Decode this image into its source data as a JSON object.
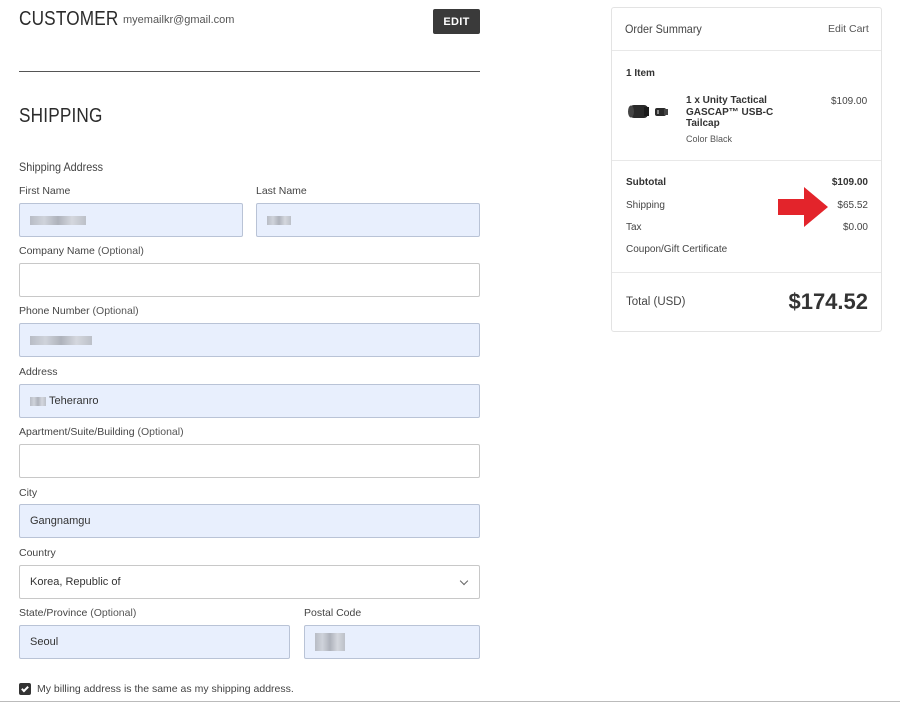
{
  "customer": {
    "heading": "CUSTOMER",
    "email": "myemailkr@gmail.com",
    "edit_label": "EDIT"
  },
  "shipping": {
    "heading": "SHIPPING",
    "subheading": "Shipping Address",
    "fields": {
      "first_name": {
        "label": "First Name",
        "value": ""
      },
      "last_name": {
        "label": "Last Name",
        "value": ""
      },
      "company": {
        "label": "Company Name",
        "optional": " (Optional)",
        "value": ""
      },
      "phone": {
        "label": "Phone Number",
        "optional": " (Optional)",
        "value": ""
      },
      "address": {
        "label": "Address",
        "value": "Teheranro"
      },
      "apartment": {
        "label": "Apartment/Suite/Building",
        "optional": " (Optional)",
        "value": ""
      },
      "city": {
        "label": "City",
        "value": "Gangnamgu"
      },
      "country": {
        "label": "Country",
        "value": "Korea, Republic of"
      },
      "state": {
        "label": "State/Province",
        "optional": " (Optional)",
        "value": "Seoul"
      },
      "postal": {
        "label": "Postal Code",
        "value": ""
      }
    },
    "billing_same_label": "My billing address is the same as my shipping address.",
    "billing_same_checked": true
  },
  "order_summary": {
    "title": "Order Summary",
    "edit_cart": "Edit Cart",
    "item_count": "1 Item",
    "item": {
      "name": "1 x Unity Tactical GASCAP™ USB-C Tailcap",
      "option": "Color Black",
      "price": "$109.00"
    },
    "subtotal_label": "Subtotal",
    "subtotal_value": "$109.00",
    "shipping_label": "Shipping",
    "shipping_value": "$65.52",
    "tax_label": "Tax",
    "tax_value": "$0.00",
    "coupon_label": "Coupon/Gift Certificate",
    "total_label": "Total (USD)",
    "total_value": "$174.52"
  },
  "colors": {
    "autofill_bg": "#e8effd",
    "edit_button_bg": "#3a3a3a",
    "annotation_arrow": "#e3242b"
  }
}
